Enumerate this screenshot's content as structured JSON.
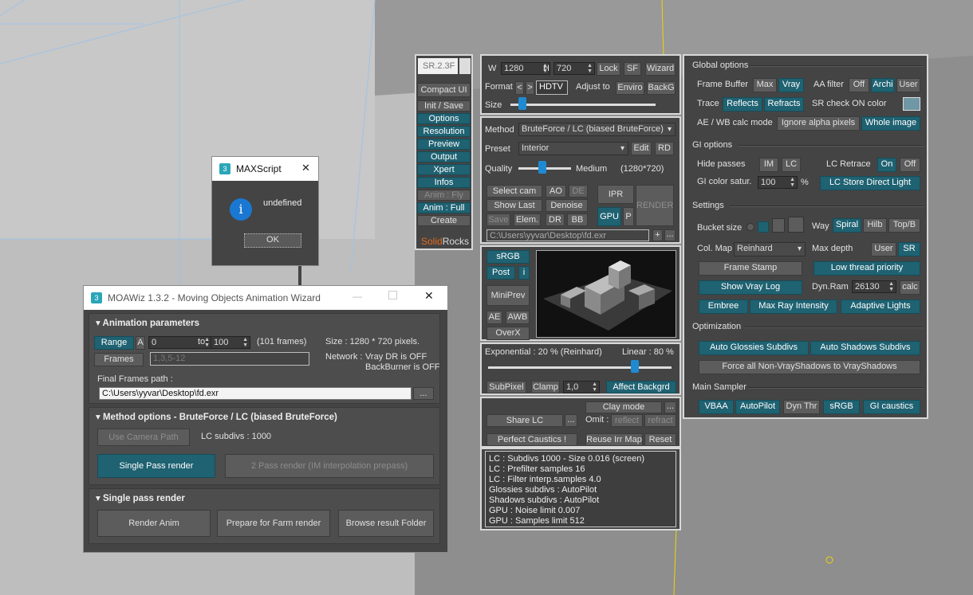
{
  "sr_toolbar": {
    "title": "SR.2.3F",
    "items": [
      "Compact UI",
      "Init / Save",
      "Options",
      "Resolution",
      "Preview",
      "Output",
      "Xpert",
      "Infos",
      "Anim : Fly",
      "Anim : Full",
      "Create"
    ],
    "brand_solid": "Solid",
    "brand_rocks": "Rocks"
  },
  "maxscript": {
    "title": "MAXScript",
    "message": "undefined",
    "ok": "OK",
    "close": "✕"
  },
  "moawiz": {
    "title": "MOAWiz 1.3.2 - Moving Objects Animation Wizard",
    "anim_params": {
      "header": "Animation parameters",
      "range": "Range",
      "a": "A",
      "from": "0",
      "to_label": "to",
      "to": "100",
      "frames_count": "(101 frames)",
      "size": "Size : 1280 * 720 pixels.",
      "frames_btn": "Frames",
      "frames_placeholder": "1,3,5-12",
      "network": "Network :",
      "vray_dr": "Vray DR is OFF",
      "backburner": "BackBurner is OFF",
      "final_path_label": "Final Frames path :",
      "final_path": "C:\\Users\\yyvar\\Desktop\\fd.exr",
      "browse": "..."
    },
    "method": {
      "header": "Method options - BruteForce / LC (biased BruteForce)",
      "use_camera_path": "Use Camera Path",
      "lc_subdivs": "LC subdivs : 1000",
      "single_pass": "Single Pass render",
      "two_pass": "2 Pass render (IM interpolation prepass)"
    },
    "single": {
      "header": "Single pass render",
      "render_anim": "Render Anim",
      "prepare_farm": "Prepare for Farm render",
      "browse_result": "Browse result Folder"
    }
  },
  "output": {
    "w_label": "W",
    "w": "1280",
    "h_label": "H",
    "h": "720",
    "lock": "Lock",
    "sf": "SF",
    "wizard": "Wizard",
    "format_label": "Format",
    "fmt_prev": "<",
    "fmt_next": ">",
    "format": "HDTV",
    "adjust_label": "Adjust to",
    "enviro": "Enviro",
    "backg": "BackG",
    "size_label": "Size",
    "size_frac": 0.08
  },
  "method_panel": {
    "method_label": "Method",
    "method": "BruteForce / LC (biased BruteForce)",
    "preset_label": "Preset",
    "preset": "Interior",
    "edit": "Edit",
    "rd": "RD",
    "quality_label": "Quality",
    "quality": "Medium",
    "quality_res": "(1280*720)",
    "quality_frac": 0.45,
    "select_cam": "Select cam",
    "ao": "AO",
    "de": "DE",
    "ipr": "IPR",
    "render": "RENDER",
    "show_last": "Show Last",
    "denoise": "Denoise",
    "gpu": "GPU",
    "p": "P",
    "save": "Save",
    "elem": "Elem.",
    "dr": "DR",
    "bb": "BB",
    "path": "C:\\Users\\yyvar\\Desktop\\fd.exr",
    "plus": "+",
    "dots": "..."
  },
  "preview": {
    "srgb": "sRGB",
    "post": "Post",
    "i": "i",
    "miniprev": "MiniPrev",
    "ae": "AE",
    "awb": "AWB",
    "overx": "OverX"
  },
  "exposure": {
    "exp_label": "Exponential : 20 %  (Reinhard)",
    "lin_label": "Linear : 80 %",
    "slider_frac": 0.8,
    "subpixel": "SubPixel",
    "clamp": "Clamp",
    "clamp_val": "1,0",
    "affect": "Affect Backgrd"
  },
  "clay": {
    "clay_mode": "Clay mode",
    "dots": "...",
    "share_lc": "Share LC",
    "dots2": "...",
    "omit": "Omit :",
    "reflect": "reflect",
    "refract": "refract",
    "perfect_caustics": "Perfect Caustics !",
    "reuse": "Reuse Irr Map",
    "reset": "Reset"
  },
  "info_lines": [
    "LC : Subdivs 1000 - Size 0.016 (screen)",
    "LC : Prefilter samples 16",
    "LC : Filter interp.samples  4.0",
    "Glossies subdivs : AutoPilot",
    "Shadows subdivs : AutoPilot",
    "GPU : Noise limit 0.007",
    "GPU : Samples limit 512"
  ],
  "options": {
    "global": "Global options",
    "frame_buffer": "Frame Buffer",
    "max": "Max",
    "vray": "Vray",
    "aa_filter": "AA filter",
    "off": "Off",
    "archi": "Archi",
    "user": "User",
    "trace": "Trace",
    "reflects": "Reflects",
    "refracts": "Refracts",
    "sr_check": "SR check ON color",
    "check_color": "#6f97a6",
    "ae_wb": "AE / WB calc mode",
    "ignore_alpha": "Ignore alpha pixels",
    "whole_image": "Whole image",
    "gi": "GI options",
    "hide_passes": "Hide passes",
    "im": "IM",
    "lc": "LC",
    "lc_retrace": "LC Retrace",
    "on": "On",
    "off2": "Off",
    "gi_color": "GI color satur.",
    "gi_val": "100",
    "pct": "%",
    "lc_store": "LC Store Direct Light",
    "settings": "Settings",
    "bucket_size": "Bucket size",
    "way": "Way",
    "spiral": "Spiral",
    "hilb": "Hilb",
    "topb": "Top/B",
    "col_map": "Col. Map",
    "col_map_val": "Reinhard",
    "max_depth": "Max depth",
    "user2": "User",
    "sr": "SR",
    "frame_stamp": "Frame Stamp",
    "low_thread": "Low thread priority",
    "show_vray_log": "Show Vray Log",
    "dyn_ram": "Dyn.Ram",
    "dyn_val": "26130",
    "calc": "calc",
    "embree": "Embree",
    "max_ray": "Max Ray Intensity",
    "adaptive": "Adaptive Lights",
    "optimization": "Optimization",
    "auto_glossies": "Auto Glossies Subdivs",
    "auto_shadows": "Auto Shadows Subdivs",
    "force_all": "Force all Non-VrayShadows to VrayShadows",
    "main_sampler": "Main Sampler",
    "vbaa": "VBAA",
    "autopilot": "AutoPilot",
    "dyn_thr": "Dyn Thr",
    "srgb": "sRGB",
    "gi_caustics": "GI caustics"
  }
}
